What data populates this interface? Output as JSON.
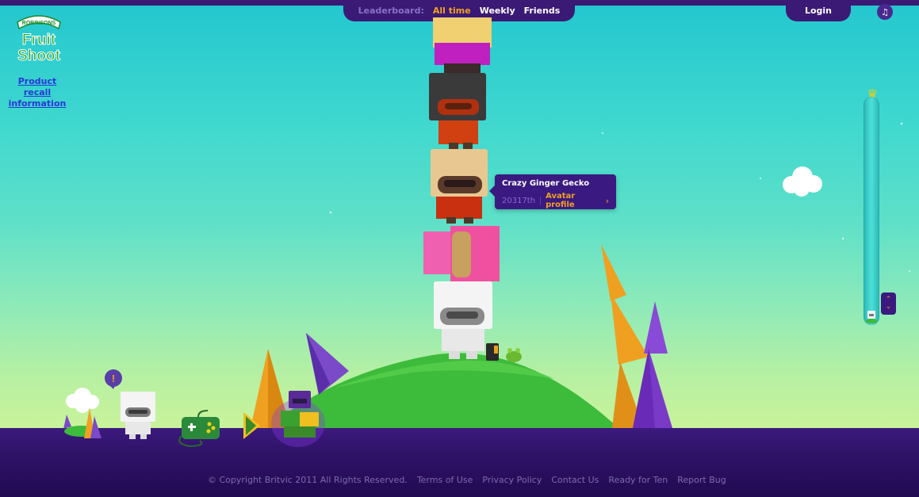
{
  "leaderboard_nav": {
    "title": "Leaderboard:",
    "tabs": [
      {
        "label": "All time",
        "active": true
      },
      {
        "label": "Weekly",
        "active": false
      },
      {
        "label": "Friends",
        "active": false
      }
    ]
  },
  "header": {
    "login_label": "Login",
    "music_icon": "music-note-icon"
  },
  "brand": {
    "logo_top": "ROBINSONS",
    "logo_line1": "Fruit",
    "logo_line2": "Shoot",
    "recall_link": "Product recall information"
  },
  "tooltip": {
    "avatar_name": "Crazy Ginger Gecko",
    "rank": "20317th",
    "profile_link": "Avatar profile",
    "chevron_icon": "chevron-right-icon"
  },
  "rank_slider": {
    "top_icon": "crown-icon",
    "handle_icon": "up-down-arrows-icon"
  },
  "toolbar": {
    "items": [
      "notification-icon",
      "cloud-world-icon",
      "avatar-icon",
      "gamepad-icon",
      "play-arrow-icon",
      "avatar-stack-icon"
    ],
    "alert_symbol": "!"
  },
  "footer": {
    "copyright": "© Copyright Britvic 2011 All Rights Reserved.",
    "links": [
      "Terms of Use",
      "Privacy Policy",
      "Contact Us",
      "Ready for Ten",
      "Report Bug"
    ]
  },
  "colors": {
    "brand_purple": "#3a1a75",
    "accent_orange": "#f0a020",
    "sky_top": "#23c6cf",
    "hill_green": "#3dbb3a"
  }
}
